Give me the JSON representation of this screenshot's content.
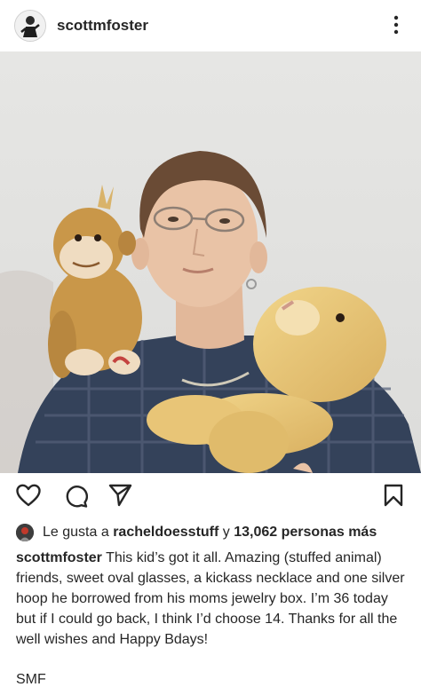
{
  "header": {
    "username": "scottmfoster",
    "more_icon": "more-vertical-icon"
  },
  "photo": {
    "description_icon": "post-photo"
  },
  "actions": {
    "like_icon": "heart-icon",
    "comment_icon": "comment-icon",
    "share_icon": "send-icon",
    "save_icon": "bookmark-icon"
  },
  "likes": {
    "prefix": "Le gusta a",
    "liker": "racheldoesstuff",
    "connector": "y",
    "count_text": "13,062 personas más"
  },
  "caption": {
    "username": "scottmfoster",
    "text": "This kid’s got it all. Amazing (stuffed animal) friends, sweet oval glasses, a kickass necklace and one silver hoop he borrowed from his moms jewelry box. I’m 36 today but if I could go back, I think I’d choose 14. Thanks for all the well wishes and Happy Bdays!",
    "signoff": "SMF"
  }
}
